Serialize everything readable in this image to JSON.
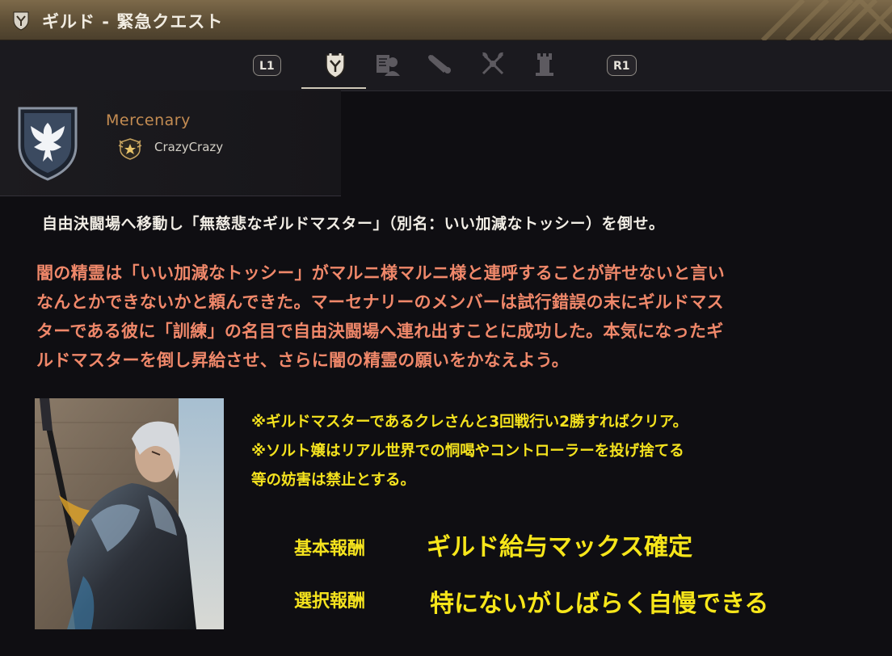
{
  "window": {
    "title": "ギルド - 緊急クエスト",
    "title_icon": "guild-crest-icon"
  },
  "nav": {
    "left_button": "L1",
    "right_button": "R1",
    "tabs": [
      {
        "icon": "guild-crest-icon",
        "active": true
      },
      {
        "icon": "guild-member-icon",
        "active": false
      },
      {
        "icon": "scroll-icon",
        "active": false
      },
      {
        "icon": "crossed-axes-icon",
        "active": false
      },
      {
        "icon": "tower-icon",
        "active": false
      }
    ]
  },
  "guild": {
    "name": "Mercenary",
    "master": "CrazyCrazy",
    "emblem_icon": "eagle-shield-icon",
    "master_icon": "guild-master-badge-icon"
  },
  "quest": {
    "objective": "自由決闘場へ移動し「無慈悲なギルドマスター」（別名：いい加減なトッシー）を倒せ。",
    "story": [
      "闇の精霊は「いい加減なトッシー」がマルニ様マルニ様と連呼することが許せないと言い",
      "なんとかできないかと頼んできた。マーセナリーのメンバーは試行錯誤の末にギルドマス",
      "ターである彼に「訓練」の名目で自由決闘場へ連れ出すことに成功した。本気になったギ",
      "ルドマスターを倒し昇給させ、さらに闇の精霊の願いをかなえよう。"
    ],
    "notes": [
      "※ギルドマスターであるクレさんと3回戦行い2勝すればクリア。",
      "※ソルト嬢はリアル世界での恫喝やコントローラーを投げ捨てる",
      "等の妨害は禁止とする。"
    ],
    "rewards": {
      "basic_label": "基本報酬",
      "basic_value": "ギルド給与マックス確定",
      "select_label": "選択報酬",
      "select_value": "特にないがしばらく自慢できる"
    }
  },
  "colors": {
    "title_bar": "#6b5a3f",
    "guild_name": "#c48c52",
    "story_text": "#f0886a",
    "highlight_text": "#f4e21e",
    "background": "#0f0e12"
  }
}
